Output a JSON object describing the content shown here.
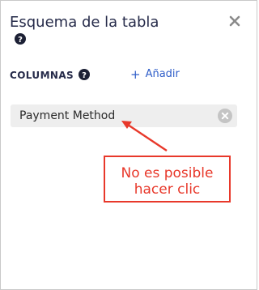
{
  "panel": {
    "title": "Esquema de la tabla",
    "close_icon": "close-icon",
    "help_icon": "question-circle-icon"
  },
  "columns_section": {
    "label": "COLUMNAS",
    "add_label": "Añadir",
    "add_icon": "plus-icon",
    "items": [
      {
        "label": "Payment Method",
        "remove_icon": "remove-circle-icon"
      }
    ]
  },
  "annotation": {
    "line1": "No es posible",
    "line2": "hacer clic",
    "color": "#e8382a"
  },
  "colors": {
    "title": "#262b4a",
    "link": "#2f5ec9",
    "item_bg": "#eeeeee"
  }
}
